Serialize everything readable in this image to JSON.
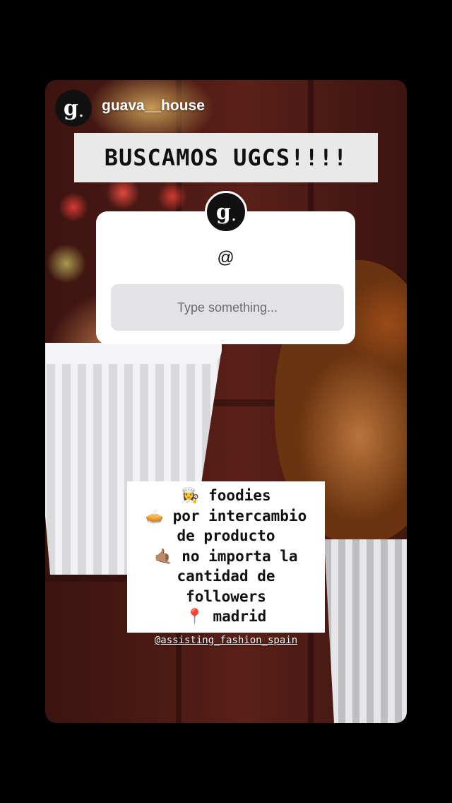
{
  "header": {
    "username": "guava__house",
    "avatar_letter": "g",
    "avatar_dot": "."
  },
  "banner": {
    "text": "BUSCAMOS UGCS!!!!"
  },
  "question_sticker": {
    "avatar_letter": "g",
    "avatar_dot": ".",
    "question": "@",
    "input_placeholder": "Type something..."
  },
  "info_box": {
    "lines": [
      "👩‍🍳 foodies",
      "🥧 por intercambio",
      "de producto",
      "🤙🏽 no importa la",
      "cantidad de",
      "followers",
      "📍 madrid"
    ]
  },
  "mention": "@assisting_fashion_spain",
  "colors": {
    "background": "#000000",
    "card": "#ffffff",
    "input": "#e3e3e5",
    "banner": "#e9e9e9"
  }
}
